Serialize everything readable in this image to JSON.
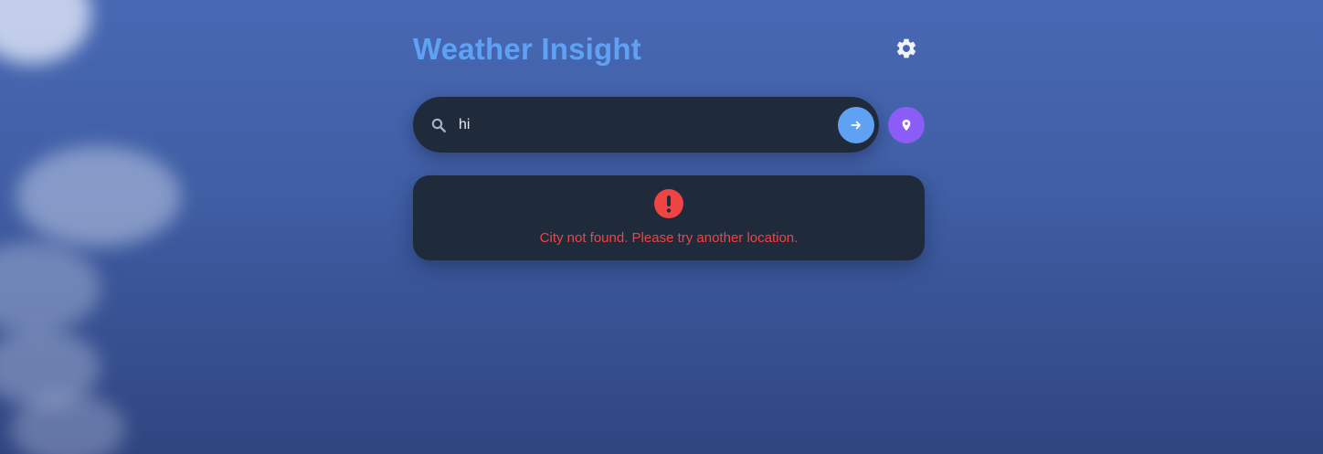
{
  "app": {
    "title": "Weather Insight",
    "accent_color": "#5fa2f3"
  },
  "header": {
    "settings_icon": "gear-icon"
  },
  "search": {
    "icon": "search-icon",
    "value": "hi",
    "submit_icon": "arrow-right-icon",
    "submit_color": "#5fa2f3",
    "location_icon": "map-pin-icon",
    "location_color": "#8b5cf6"
  },
  "error": {
    "icon": "exclamation-circle-icon",
    "message": "City not found. Please try another location.",
    "color": "#ef4444"
  }
}
